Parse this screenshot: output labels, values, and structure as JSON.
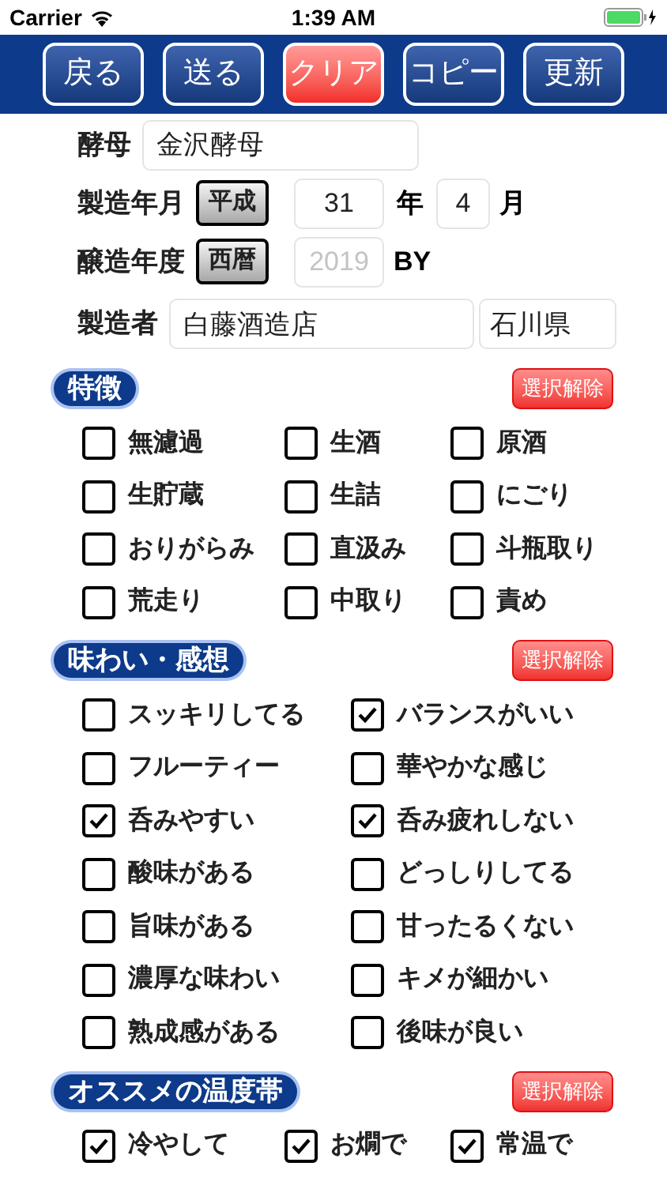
{
  "status_bar": {
    "carrier": "Carrier",
    "time": "1:39 AM"
  },
  "toolbar": [
    {
      "label": "戻る",
      "kind": "normal"
    },
    {
      "label": "送る",
      "kind": "normal"
    },
    {
      "label": "クリア",
      "kind": "danger"
    },
    {
      "label": "コピー",
      "kind": "normal"
    },
    {
      "label": "更新",
      "kind": "normal"
    }
  ],
  "yeast": {
    "label": "酵母",
    "value": "金沢酵母"
  },
  "production_date": {
    "label": "製造年月",
    "era_button": "平成",
    "year": "31",
    "year_unit": "年",
    "month": "4",
    "month_unit": "月"
  },
  "brewing_year": {
    "label": "醸造年度",
    "era_button": "西暦",
    "placeholder": "2019",
    "suffix": "BY"
  },
  "maker": {
    "label": "製造者",
    "name": "白藤酒造店",
    "prefecture": "石川県"
  },
  "sections": [
    {
      "title": "特徴",
      "clear_button": "選択解除",
      "kind": "three_column",
      "options": [
        {
          "label": "無濾過",
          "checked": false
        },
        {
          "label": "生酒",
          "checked": false
        },
        {
          "label": "原酒",
          "checked": false
        },
        {
          "label": "生貯蔵",
          "checked": false
        },
        {
          "label": "生詰",
          "checked": false
        },
        {
          "label": "にごり",
          "checked": false
        },
        {
          "label": "おりがらみ",
          "checked": false
        },
        {
          "label": "直汲み",
          "checked": false
        },
        {
          "label": "斗瓶取り",
          "checked": false
        },
        {
          "label": "荒走り",
          "checked": false
        },
        {
          "label": "中取り",
          "checked": false
        },
        {
          "label": "責め",
          "checked": false
        }
      ]
    },
    {
      "title": "味わい・感想",
      "clear_button": "選択解除",
      "kind": "two_column",
      "options": [
        {
          "label": "スッキリしてる",
          "checked": false
        },
        {
          "label": "バランスがいい",
          "checked": true
        },
        {
          "label": "フルーティー",
          "checked": false
        },
        {
          "label": "華やかな感じ",
          "checked": false
        },
        {
          "label": "呑みやすい",
          "checked": true
        },
        {
          "label": "呑み疲れしない",
          "checked": true
        },
        {
          "label": "酸味がある",
          "checked": false
        },
        {
          "label": "どっしりしてる",
          "checked": false
        },
        {
          "label": "旨味がある",
          "checked": false
        },
        {
          "label": "甘ったるくない",
          "checked": false
        },
        {
          "label": "濃厚な味わい",
          "checked": false
        },
        {
          "label": "キメが細かい",
          "checked": false
        },
        {
          "label": "熟成感がある",
          "checked": false
        },
        {
          "label": "後味が良い",
          "checked": false
        }
      ]
    },
    {
      "title": "オススメの温度帯",
      "clear_button": "選択解除",
      "kind": "three_column",
      "options": [
        {
          "label": "冷やして",
          "checked": true
        },
        {
          "label": "お燗で",
          "checked": true
        },
        {
          "label": "常温で",
          "checked": true
        }
      ]
    }
  ]
}
